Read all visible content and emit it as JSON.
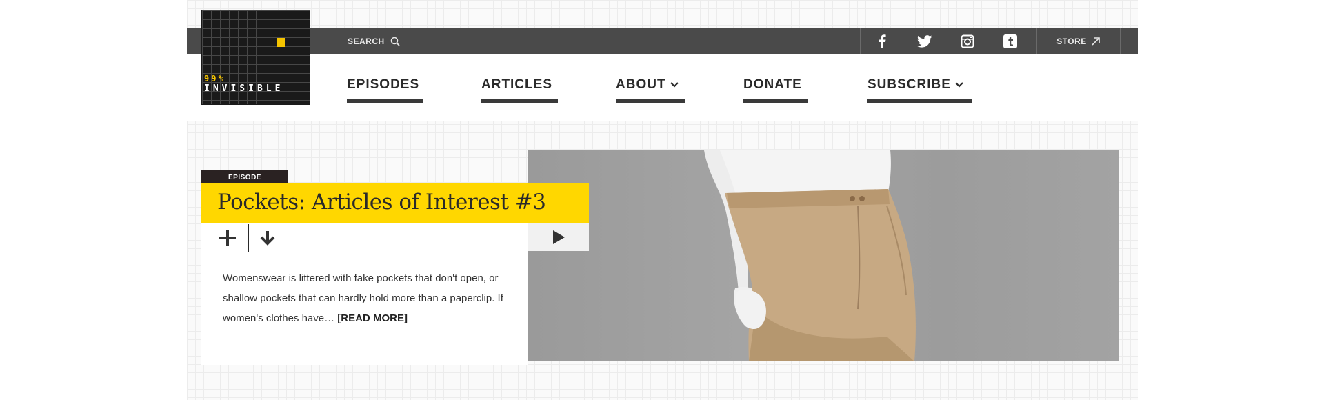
{
  "topbar": {
    "search_label": "SEARCH",
    "social": [
      {
        "name": "facebook",
        "glyph": "f"
      },
      {
        "name": "twitter",
        "glyph": "twitter-bird-icon"
      },
      {
        "name": "instagram",
        "glyph": "camera-icon"
      },
      {
        "name": "tumblr",
        "glyph": "t"
      }
    ],
    "store_label": "STORE"
  },
  "logo": {
    "percent": "99%",
    "name": "INVISIBLE",
    "accent_color": "#f5c400"
  },
  "nav": {
    "episodes": "EPISODES",
    "articles": "ARTICLES",
    "about": "ABOUT",
    "donate": "DONATE",
    "subscribe": "SUBSCRIBE"
  },
  "feature": {
    "tag": "EPISODE",
    "title": "Pockets: Articles of Interest #3",
    "add_glyph": "+",
    "description": "Womenswear is littered with fake pockets that don't open, or shallow pockets that can hardly hold more than a paperclip. If women's clothes have…",
    "read_more": "[READ MORE]",
    "title_bg_color": "#ffd700"
  },
  "hero": {
    "subject": "white mannequin wearing khaki shorts",
    "icon": "play-icon"
  }
}
